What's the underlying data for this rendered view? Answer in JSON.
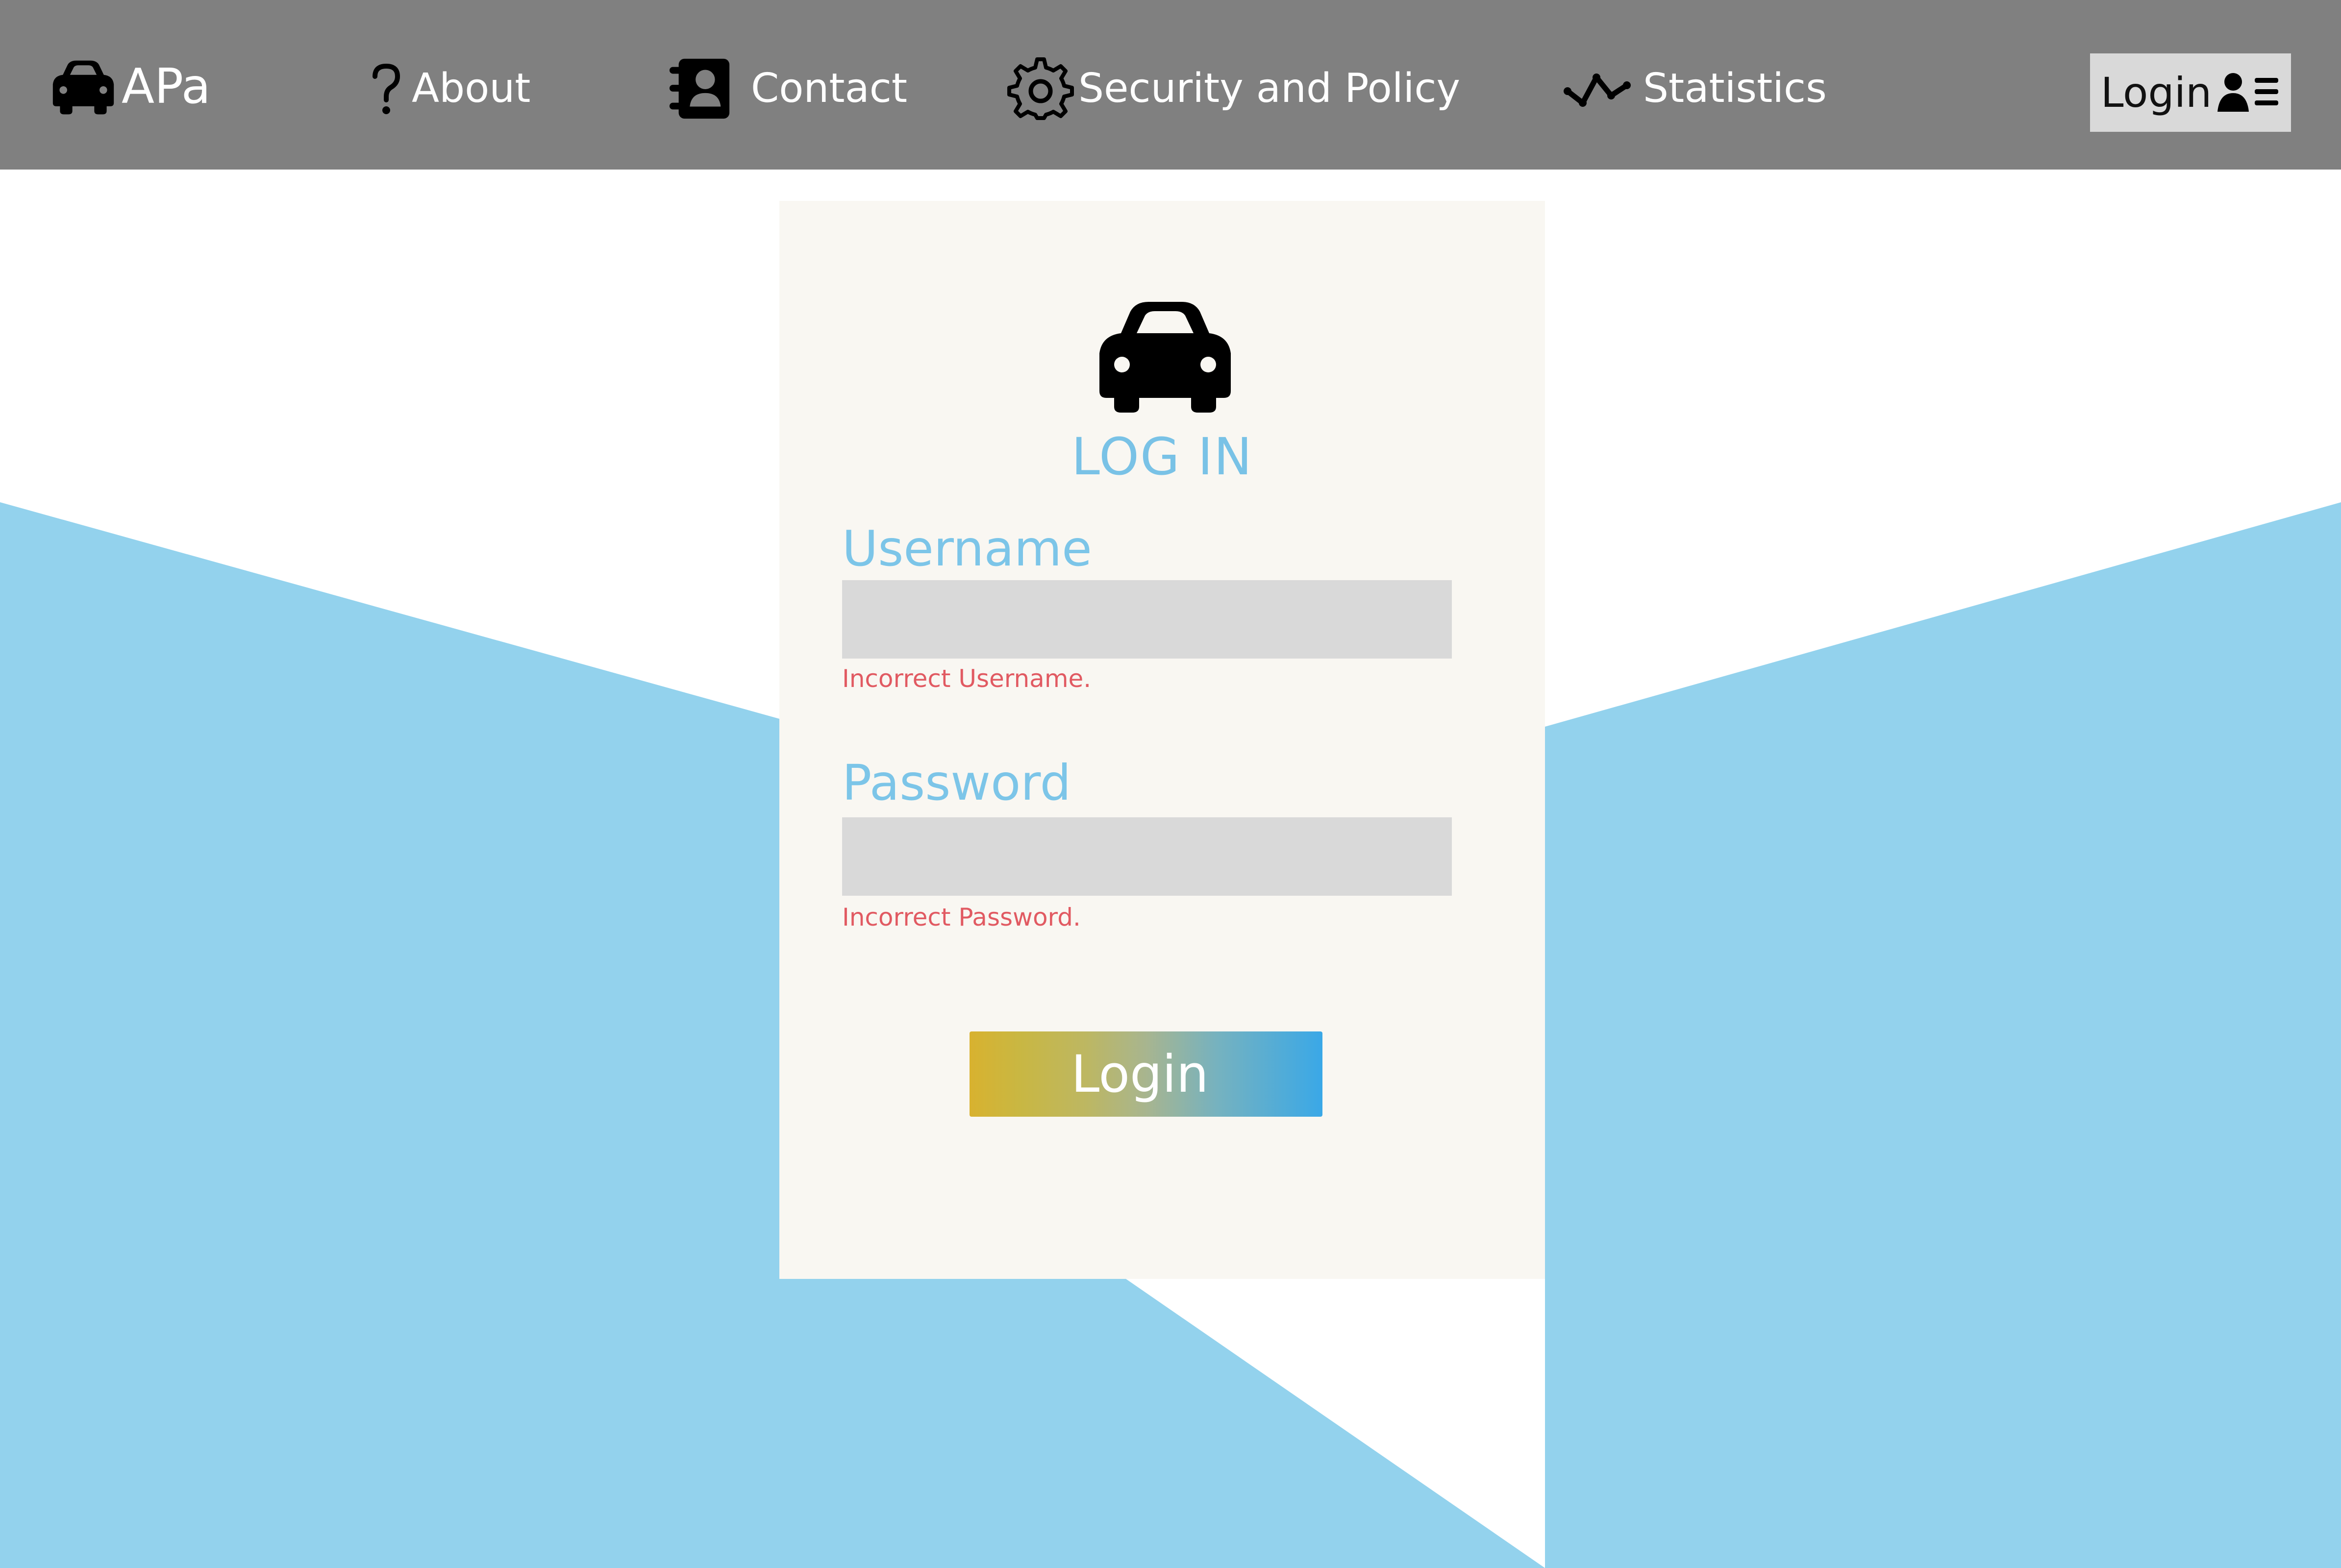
{
  "theme": {
    "header_color": "#808080",
    "background_color": "#ffffff",
    "wave_color": "#93d2ed",
    "card_color": "#f9f7f2",
    "accent_text": "#79c2e6",
    "error_text": "#e15a62",
    "button_gradient": [
      "#d8b22f",
      "#3aa8e7"
    ]
  },
  "header": {
    "brand": {
      "icon": "car-icon",
      "label": "APa"
    },
    "nav": [
      {
        "label": "About",
        "icon": "question-mark-icon"
      },
      {
        "label": "Contact",
        "icon": "contact-book-icon"
      },
      {
        "label": "Security and Policy",
        "icon": "gear-icon"
      },
      {
        "label": "Statistics",
        "icon": "line-chart-icon"
      }
    ],
    "login": {
      "label": "Login",
      "icon": "user-list-icon"
    }
  },
  "login_card": {
    "icon": "car-icon",
    "title": "LOG IN",
    "username": {
      "label": "Username",
      "value": "",
      "placeholder": "",
      "error": "Incorrect Username."
    },
    "password": {
      "label": "Password",
      "value": "",
      "placeholder": "",
      "error": "Incorrect Password."
    },
    "button_label": "Login"
  }
}
